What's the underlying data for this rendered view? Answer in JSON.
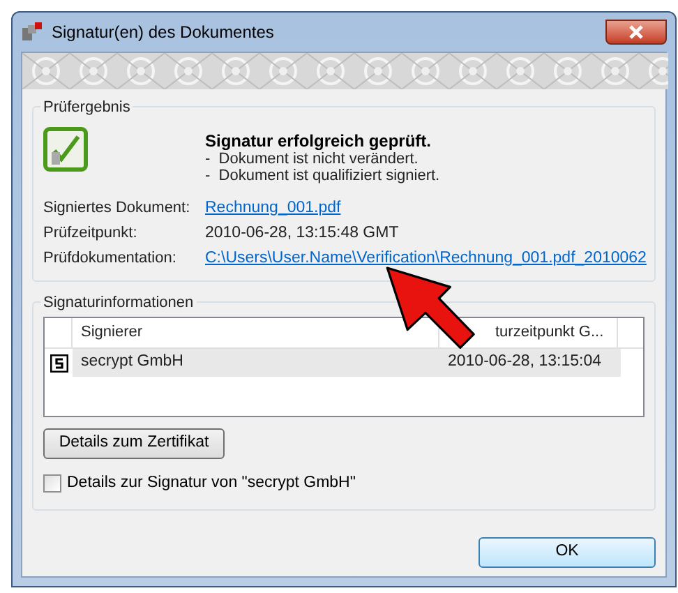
{
  "window": {
    "title": "Signatur(en) des Dokumentes"
  },
  "result_group": {
    "title": "Prüfergebnis",
    "headline": "Signatur erfolgreich geprüft.",
    "details": [
      "-  Dokument ist nicht verändert.",
      "-  Dokument ist qualifiziert signiert."
    ],
    "fields": [
      {
        "label": "Signiertes Dokument:",
        "value": "Rechnung_001.pdf",
        "kind": "link"
      },
      {
        "label": "Prüfzeitpunkt:",
        "value": "2010-06-28, 13:15:48 GMT",
        "kind": "text"
      },
      {
        "label": "Prüfdokumentation:",
        "value": "C:\\Users\\User.Name\\Verification\\Rechnung_001.pdf_2010062",
        "kind": "link"
      }
    ]
  },
  "signature_group": {
    "title": "Signaturinformationen",
    "table": {
      "columns": [
        "Signierer",
        "turzeitpunkt G..."
      ],
      "rows": [
        {
          "cells": [
            "secrypt GmbH",
            "2010-06-28, 13:15:04"
          ],
          "selected": true
        }
      ]
    },
    "certificate_button": "Details zum Zertifikat",
    "details_checkbox": {
      "label": "Details zur Signatur von \"secrypt GmbH\"",
      "checked": false
    }
  },
  "buttons": [
    "OK"
  ]
}
